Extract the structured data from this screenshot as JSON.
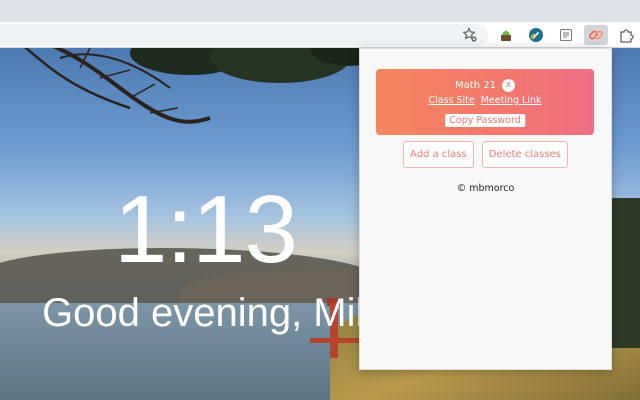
{
  "browser": {
    "extensions": [
      {
        "icon": "plant-pot-icon"
      },
      {
        "icon": "link-circle-icon"
      },
      {
        "icon": "reader-icon"
      },
      {
        "icon": "link-icon",
        "active": true
      },
      {
        "icon": "puzzle-icon"
      }
    ]
  },
  "newtab": {
    "time": "1:13",
    "greeting": "Good evening, Mike."
  },
  "popup": {
    "class": {
      "name": "Math 21",
      "remove_label": "x",
      "class_site_label": "Class Site",
      "meeting_link_label": "Meeting Link",
      "copy_password_label": "Copy Password"
    },
    "add_class_label": "Add a class",
    "delete_classes_label": "Delete classes",
    "credit": "© mbmorco"
  },
  "colors": {
    "card_gradient_start": "#f5855e",
    "card_gradient_end": "#ef6e84",
    "accent_text": "#ef7f77"
  }
}
